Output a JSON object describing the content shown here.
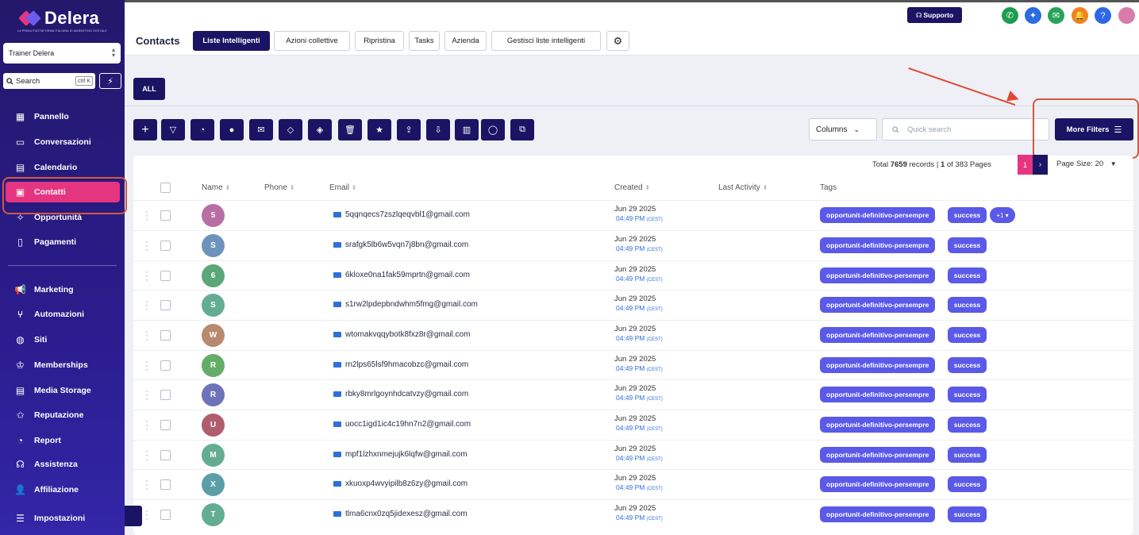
{
  "brand": {
    "name": "Delera",
    "tagline": "LA PRIMA PIATTAFORMA ITALIANA DI MARKETING DIGITALE"
  },
  "sidebar": {
    "account": "Trainer Delera",
    "search_label": "Search",
    "search_shortcut": "ctrl K",
    "items": [
      {
        "label": "Pannello",
        "icon": "dashboard-icon"
      },
      {
        "label": "Conversazioni",
        "icon": "chat-icon"
      },
      {
        "label": "Calendario",
        "icon": "calendar-icon"
      },
      {
        "label": "Contatti",
        "icon": "contacts-icon"
      },
      {
        "label": "Opportunità",
        "icon": "opportunity-icon"
      },
      {
        "label": "Pagamenti",
        "icon": "payments-icon"
      },
      {
        "label": "Marketing",
        "icon": "megaphone-icon"
      },
      {
        "label": "Automazioni",
        "icon": "automation-icon"
      },
      {
        "label": "Siti",
        "icon": "globe-icon"
      },
      {
        "label": "Memberships",
        "icon": "crown-icon"
      },
      {
        "label": "Media Storage",
        "icon": "storage-icon"
      },
      {
        "label": "Reputazione",
        "icon": "star-icon"
      },
      {
        "label": "Report",
        "icon": "report-icon"
      },
      {
        "label": "Assistenza",
        "icon": "headset-icon"
      },
      {
        "label": "Affiliazione",
        "icon": "affiliate-icon"
      },
      {
        "label": "Impostazioni",
        "icon": "settings-icon"
      }
    ]
  },
  "topbar": {
    "support_label": "Supporto"
  },
  "tabs": {
    "title": "Contacts",
    "items": [
      "Liste Intelligenti",
      "Azioni collettive",
      "Ripristina",
      "Tasks",
      "Azienda",
      "Gestisci liste intelligenti"
    ]
  },
  "list": {
    "all_label": "ALL",
    "columns_label": "Columns",
    "quick_search_placeholder": "Quick search",
    "more_filters_label": "More Filters",
    "total_prefix": "Total",
    "total_records": "7659",
    "records_suffix": "records |",
    "page_current": "1",
    "page_of": "of 383 Pages",
    "page_number": "1",
    "page_size": "Page Size: 20"
  },
  "table": {
    "headers": {
      "name": "Name",
      "phone": "Phone",
      "email": "Email",
      "created": "Created",
      "last_activity": "Last Activity",
      "tags": "Tags"
    },
    "rows": [
      {
        "initial": "5",
        "color": "#b86ea3",
        "email": "5qqnqecs7zszlqeqvbl1@gmail.com",
        "date": "Jun 29 2025",
        "time": "04:49 PM",
        "tz": "(CEST)",
        "tag1": "opportunit-definitivo-persempre",
        "tag2": "success",
        "extra": "+1 ▾"
      },
      {
        "initial": "S",
        "color": "#6d93bd",
        "email": "srafgk5lb6w5vqn7j8bn@gmail.com",
        "date": "Jun 29 2025",
        "time": "04:49 PM",
        "tz": "(CEST)",
        "tag1": "opportunit-definitivo-persempre",
        "tag2": "success"
      },
      {
        "initial": "6",
        "color": "#5aa777",
        "email": "6kloxe0na1fak59mprtn@gmail.com",
        "date": "Jun 29 2025",
        "time": "04:49 PM",
        "tz": "(CEST)",
        "tag1": "opportunit-definitivo-persempre",
        "tag2": "success"
      },
      {
        "initial": "S",
        "color": "#64ad92",
        "email": "s1rw2lpdepbndwhm5fmg@gmail.com",
        "date": "Jun 29 2025",
        "time": "04:49 PM",
        "tz": "(CEST)",
        "tag1": "opportunit-definitivo-persempre",
        "tag2": "success"
      },
      {
        "initial": "W",
        "color": "#b78a6f",
        "email": "wtomakvqqybotk8fxz8r@gmail.com",
        "date": "Jun 29 2025",
        "time": "04:49 PM",
        "tz": "(CEST)",
        "tag1": "opportunit-definitivo-persempre",
        "tag2": "success"
      },
      {
        "initial": "R",
        "color": "#63ad68",
        "email": "rn2lps65lsf9hmacobzc@gmail.com",
        "date": "Jun 29 2025",
        "time": "04:49 PM",
        "tz": "(CEST)",
        "tag1": "opportunit-definitivo-persempre",
        "tag2": "success"
      },
      {
        "initial": "R",
        "color": "#6e72b8",
        "email": "rbky8mrlgoynhdcatvzy@gmail.com",
        "date": "Jun 29 2025",
        "time": "04:49 PM",
        "tz": "(CEST)",
        "tag1": "opportunit-definitivo-persempre",
        "tag2": "success"
      },
      {
        "initial": "U",
        "color": "#b05d6e",
        "email": "uocc1igd1ic4c19hn7n2@gmail.com",
        "date": "Jun 29 2025",
        "time": "04:49 PM",
        "tz": "(CEST)",
        "tag1": "opportunit-definitivo-persempre",
        "tag2": "success"
      },
      {
        "initial": "M",
        "color": "#64ad92",
        "email": "mpf1lzhxnmejujk6lqfw@gmail.com",
        "date": "Jun 29 2025",
        "time": "04:49 PM",
        "tz": "(CEST)",
        "tag1": "opportunit-definitivo-persempre",
        "tag2": "success"
      },
      {
        "initial": "X",
        "color": "#5a9fa6",
        "email": "xkuoxp4wvyipilb8z6zy@gmail.com",
        "date": "Jun 29 2025",
        "time": "04:49 PM",
        "tz": "(CEST)",
        "tag1": "opportunit-definitivo-persempre",
        "tag2": "success"
      },
      {
        "initial": "T",
        "color": "#64ad92",
        "email": "tlma6cnx0zq5jidexesz@gmail.com",
        "date": "Jun 29 2025",
        "time": "04:49 PM",
        "tz": "(CEST)",
        "tag1": "opportunit-definitivo-persempre",
        "tag2": "success"
      }
    ]
  }
}
